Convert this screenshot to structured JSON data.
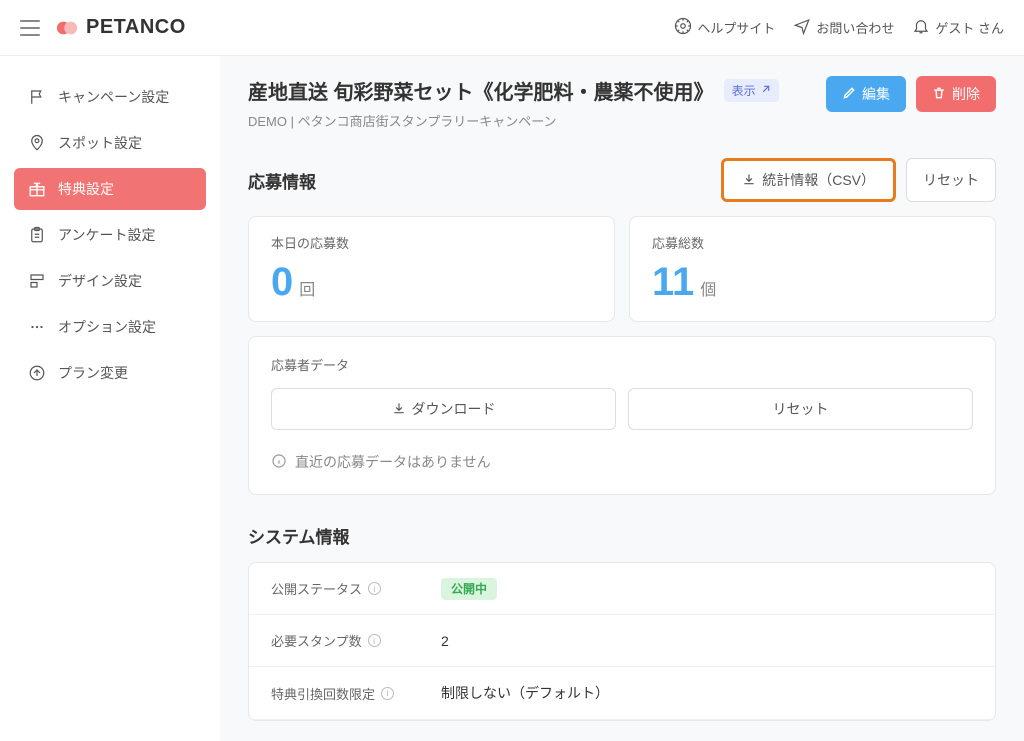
{
  "header": {
    "brand": "PETANCO",
    "help_label": "ヘルプサイト",
    "contact_label": "お問い合わせ",
    "user_label": "ゲスト さん"
  },
  "sidebar": {
    "items": [
      {
        "label": "キャンペーン設定"
      },
      {
        "label": "スポット設定"
      },
      {
        "label": "特典設定"
      },
      {
        "label": "アンケート設定"
      },
      {
        "label": "デザイン設定"
      },
      {
        "label": "オプション設定"
      },
      {
        "label": "プラン変更"
      }
    ]
  },
  "page": {
    "title": "産地直送 旬彩野菜セット《化学肥料・農薬不使用》",
    "view_badge": "表示",
    "breadcrumb": "DEMO | ペタンコ商店街スタンプラリーキャンペーン",
    "edit_label": "編集",
    "delete_label": "削除"
  },
  "application_info": {
    "section_title": "応募情報",
    "stats_csv_label": "統計情報（CSV）",
    "reset_label": "リセット",
    "today": {
      "label": "本日の応募数",
      "value": "0",
      "unit": "回"
    },
    "total": {
      "label": "応募総数",
      "value": "11",
      "unit": "個"
    },
    "applicant_data_label": "応募者データ",
    "download_label": "ダウンロード",
    "reset_data_label": "リセット",
    "empty_message": "直近の応募データはありません"
  },
  "system_info": {
    "section_title": "システム情報",
    "rows": [
      {
        "label": "公開ステータス",
        "value": "公開中",
        "badge": true
      },
      {
        "label": "必要スタンプ数",
        "value": "2"
      },
      {
        "label": "特典引換回数限定",
        "value": "制限しない（デフォルト）"
      }
    ]
  }
}
